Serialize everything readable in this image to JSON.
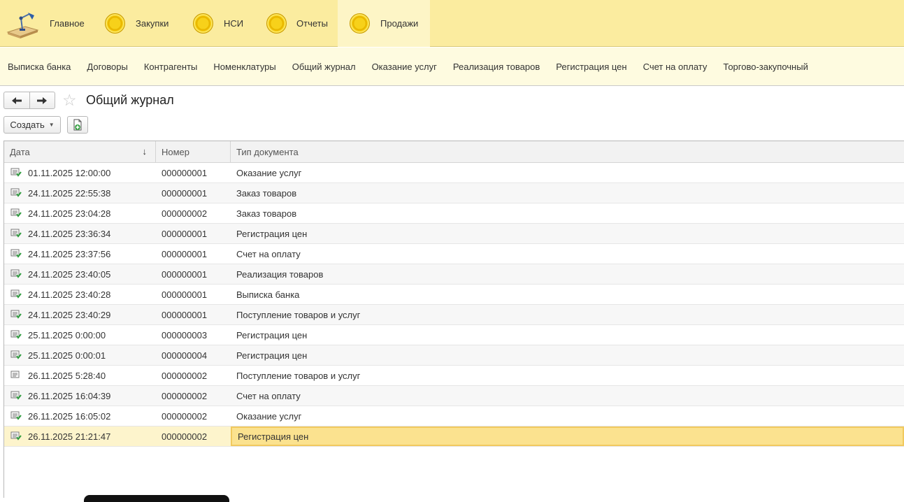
{
  "sections": [
    {
      "label": "Главное",
      "icon": "home-desk-icon",
      "active": false
    },
    {
      "label": "Закупки",
      "icon": "coin-icon",
      "active": false
    },
    {
      "label": "НСИ",
      "icon": "coin-icon",
      "active": false
    },
    {
      "label": "Отчеты",
      "icon": "coin-icon",
      "active": false
    },
    {
      "label": "Продажи",
      "icon": "coin-icon",
      "active": true
    }
  ],
  "subnav": [
    "Выписка банка",
    "Договоры",
    "Контрагенты",
    "Номенклатуры",
    "Общий журнал",
    "Оказание услуг",
    "Реализация товаров",
    "Регистрация цен",
    "Счет на оплату",
    "Торгово-закупочный"
  ],
  "toolbar": {
    "back_icon": "arrow-left-icon",
    "forward_icon": "arrow-right-icon",
    "favorite_icon": "star-icon",
    "title": "Общий журнал",
    "create_label": "Создать",
    "copy_icon": "copy-document-icon"
  },
  "table": {
    "columns": [
      "Дата",
      "Номер",
      "Тип документа"
    ],
    "sort_icon": "sort-down-arrow-icon",
    "rows": [
      {
        "date": "01.11.2025 12:00:00",
        "number": "000000001",
        "type": "Оказание услуг",
        "posted": true
      },
      {
        "date": "24.11.2025 22:55:38",
        "number": "000000001",
        "type": "Заказ товаров",
        "posted": true
      },
      {
        "date": "24.11.2025 23:04:28",
        "number": "000000002",
        "type": "Заказ товаров",
        "posted": true
      },
      {
        "date": "24.11.2025 23:36:34",
        "number": "000000001",
        "type": "Регистрация цен",
        "posted": true
      },
      {
        "date": "24.11.2025 23:37:56",
        "number": "000000001",
        "type": "Счет на оплату",
        "posted": true
      },
      {
        "date": "24.11.2025 23:40:05",
        "number": "000000001",
        "type": "Реализация товаров",
        "posted": true
      },
      {
        "date": "24.11.2025 23:40:28",
        "number": "000000001",
        "type": "Выписка банка",
        "posted": true
      },
      {
        "date": "24.11.2025 23:40:29",
        "number": "000000001",
        "type": "Поступление товаров и услуг",
        "posted": true
      },
      {
        "date": "25.11.2025 0:00:00",
        "number": "000000003",
        "type": "Регистрация цен",
        "posted": true
      },
      {
        "date": "25.11.2025 0:00:01",
        "number": "000000004",
        "type": "Регистрация цен",
        "posted": true
      },
      {
        "date": "26.11.2025 5:28:40",
        "number": "000000002",
        "type": "Поступление товаров и услуг",
        "posted": false
      },
      {
        "date": "26.11.2025 16:04:39",
        "number": "000000002",
        "type": "Счет на оплату",
        "posted": true
      },
      {
        "date": "26.11.2025 16:05:02",
        "number": "000000002",
        "type": "Оказание услуг",
        "posted": true
      },
      {
        "date": "26.11.2025 21:21:47",
        "number": "000000002",
        "type": "Регистрация цен",
        "posted": true,
        "selected": true
      }
    ]
  }
}
